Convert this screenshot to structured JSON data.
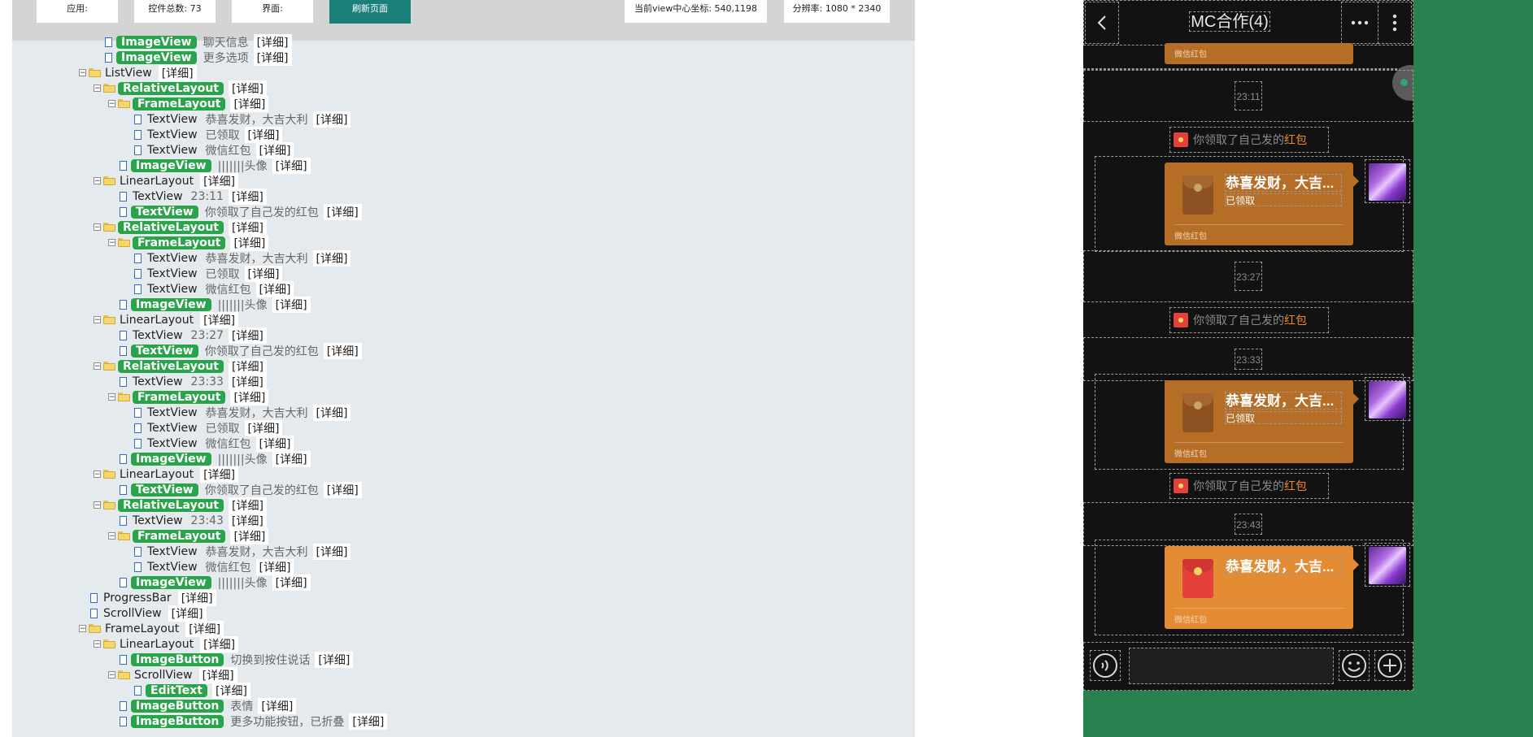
{
  "toolbar": {
    "app_label": "应用:",
    "count_label": "控件总数: 73",
    "screen_label": "界面:",
    "refresh_label": "刷新页面",
    "center_coord_label": "当前view中心坐标: 540,1198",
    "resolution_label": "分辨率: 1080 * 2340"
  },
  "detail_label": "[详细]",
  "tree": [
    {
      "depth": 2,
      "kind": "file",
      "cls": "ImageView",
      "hl": true,
      "text": "聊天信息"
    },
    {
      "depth": 2,
      "kind": "file",
      "cls": "ImageView",
      "hl": true,
      "text": "更多选项"
    },
    {
      "depth": 1,
      "kind": "folder",
      "cls": "ListView",
      "hl": false,
      "text": ""
    },
    {
      "depth": 2,
      "kind": "folder",
      "cls": "RelativeLayout",
      "hl": true,
      "text": ""
    },
    {
      "depth": 3,
      "kind": "folder",
      "cls": "FrameLayout",
      "hl": true,
      "text": ""
    },
    {
      "depth": 4,
      "kind": "file",
      "cls": "TextView",
      "hl": false,
      "text": "恭喜发财，大吉大利"
    },
    {
      "depth": 4,
      "kind": "file",
      "cls": "TextView",
      "hl": false,
      "text": "已领取"
    },
    {
      "depth": 4,
      "kind": "file",
      "cls": "TextView",
      "hl": false,
      "text": "微信红包"
    },
    {
      "depth": 3,
      "kind": "file",
      "cls": "ImageView",
      "hl": true,
      "text": "|||||||头像"
    },
    {
      "depth": 2,
      "kind": "folder",
      "cls": "LinearLayout",
      "hl": false,
      "text": ""
    },
    {
      "depth": 3,
      "kind": "file",
      "cls": "TextView",
      "hl": false,
      "text": "23:11"
    },
    {
      "depth": 3,
      "kind": "file",
      "cls": "TextView",
      "hl": true,
      "text": "你领取了自己发的红包"
    },
    {
      "depth": 2,
      "kind": "folder",
      "cls": "RelativeLayout",
      "hl": true,
      "text": ""
    },
    {
      "depth": 3,
      "kind": "folder",
      "cls": "FrameLayout",
      "hl": true,
      "text": ""
    },
    {
      "depth": 4,
      "kind": "file",
      "cls": "TextView",
      "hl": false,
      "text": "恭喜发财，大吉大利"
    },
    {
      "depth": 4,
      "kind": "file",
      "cls": "TextView",
      "hl": false,
      "text": "已领取"
    },
    {
      "depth": 4,
      "kind": "file",
      "cls": "TextView",
      "hl": false,
      "text": "微信红包"
    },
    {
      "depth": 3,
      "kind": "file",
      "cls": "ImageView",
      "hl": true,
      "text": "|||||||头像"
    },
    {
      "depth": 2,
      "kind": "folder",
      "cls": "LinearLayout",
      "hl": false,
      "text": ""
    },
    {
      "depth": 3,
      "kind": "file",
      "cls": "TextView",
      "hl": false,
      "text": "23:27"
    },
    {
      "depth": 3,
      "kind": "file",
      "cls": "TextView",
      "hl": true,
      "text": "你领取了自己发的红包"
    },
    {
      "depth": 2,
      "kind": "folder",
      "cls": "RelativeLayout",
      "hl": true,
      "text": ""
    },
    {
      "depth": 3,
      "kind": "file",
      "cls": "TextView",
      "hl": false,
      "text": "23:33"
    },
    {
      "depth": 3,
      "kind": "folder",
      "cls": "FrameLayout",
      "hl": true,
      "text": ""
    },
    {
      "depth": 4,
      "kind": "file",
      "cls": "TextView",
      "hl": false,
      "text": "恭喜发财，大吉大利"
    },
    {
      "depth": 4,
      "kind": "file",
      "cls": "TextView",
      "hl": false,
      "text": "已领取"
    },
    {
      "depth": 4,
      "kind": "file",
      "cls": "TextView",
      "hl": false,
      "text": "微信红包"
    },
    {
      "depth": 3,
      "kind": "file",
      "cls": "ImageView",
      "hl": true,
      "text": "|||||||头像"
    },
    {
      "depth": 2,
      "kind": "folder",
      "cls": "LinearLayout",
      "hl": false,
      "text": ""
    },
    {
      "depth": 3,
      "kind": "file",
      "cls": "TextView",
      "hl": true,
      "text": "你领取了自己发的红包"
    },
    {
      "depth": 2,
      "kind": "folder",
      "cls": "RelativeLayout",
      "hl": true,
      "text": ""
    },
    {
      "depth": 3,
      "kind": "file",
      "cls": "TextView",
      "hl": false,
      "text": "23:43"
    },
    {
      "depth": 3,
      "kind": "folder",
      "cls": "FrameLayout",
      "hl": true,
      "text": ""
    },
    {
      "depth": 4,
      "kind": "file",
      "cls": "TextView",
      "hl": false,
      "text": "恭喜发财，大吉大利"
    },
    {
      "depth": 4,
      "kind": "file",
      "cls": "TextView",
      "hl": false,
      "text": "微信红包"
    },
    {
      "depth": 3,
      "kind": "file",
      "cls": "ImageView",
      "hl": true,
      "text": "|||||||头像"
    },
    {
      "depth": 1,
      "kind": "file",
      "cls": "ProgressBar",
      "hl": false,
      "text": ""
    },
    {
      "depth": 1,
      "kind": "file",
      "cls": "ScrollView",
      "hl": false,
      "text": ""
    },
    {
      "depth": 1,
      "kind": "folder",
      "cls": "FrameLayout",
      "hl": false,
      "text": ""
    },
    {
      "depth": 2,
      "kind": "folder",
      "cls": "LinearLayout",
      "hl": false,
      "text": ""
    },
    {
      "depth": 3,
      "kind": "file",
      "cls": "ImageButton",
      "hl": true,
      "text": "切换到按住说话"
    },
    {
      "depth": 3,
      "kind": "folder",
      "cls": "ScrollView",
      "hl": false,
      "text": ""
    },
    {
      "depth": 4,
      "kind": "file",
      "cls": "EditText",
      "hl": true,
      "text": ""
    },
    {
      "depth": 3,
      "kind": "file",
      "cls": "ImageButton",
      "hl": true,
      "text": "表情"
    },
    {
      "depth": 3,
      "kind": "file",
      "cls": "ImageButton",
      "hl": true,
      "text": "更多功能按钮，已折叠"
    }
  ],
  "phone": {
    "title": "MC合作(4)",
    "top_partial_footer": "微信红包",
    "messages": [
      {
        "type": "time",
        "text": "23:11"
      },
      {
        "type": "system",
        "prefix": "你领取了自己发的",
        "link": "红包"
      },
      {
        "type": "packet",
        "title": "恭喜发财，大吉...",
        "status": "已领取",
        "footer": "微信红包",
        "opened": true
      },
      {
        "type": "time",
        "text": "23:27"
      },
      {
        "type": "system",
        "prefix": "你领取了自己发的",
        "link": "红包"
      },
      {
        "type": "time",
        "text": "23:33"
      },
      {
        "type": "packet",
        "title": "恭喜发财，大吉...",
        "status": "已领取",
        "footer": "微信红包",
        "opened": true
      },
      {
        "type": "system",
        "prefix": "你领取了自己发的",
        "link": "红包"
      },
      {
        "type": "time",
        "text": "23:43"
      },
      {
        "type": "packet",
        "title": "恭喜发财，大吉...",
        "status": "",
        "footer": "微信红包",
        "opened": false
      }
    ]
  }
}
